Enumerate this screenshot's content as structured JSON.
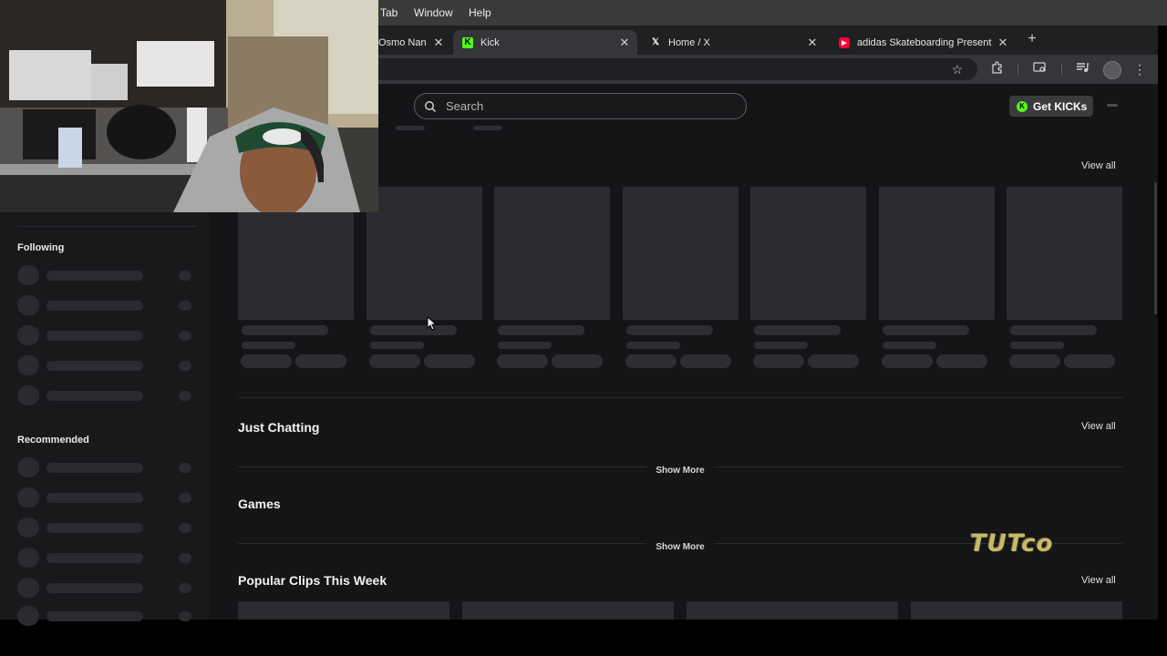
{
  "menubar": {
    "items": [
      "Tab",
      "Window",
      "Help"
    ]
  },
  "tabs": [
    {
      "title": "Osmo Nan",
      "active": false
    },
    {
      "title": "Kick",
      "active": true
    },
    {
      "title": "Home / X",
      "active": false
    },
    {
      "title": "adidas Skateboarding Present",
      "active": false
    }
  ],
  "search": {
    "placeholder": "Search"
  },
  "header": {
    "get_kicks_label": "Get KICKs"
  },
  "sections": {
    "view_all": "View all",
    "just_chatting": "Just Chatting",
    "games": "Games",
    "show_more": "Show More",
    "popular_clips": "Popular Clips This Week"
  },
  "sidebar": {
    "following": "Following",
    "recommended": "Recommended"
  },
  "watermark": "TUTco",
  "colors": {
    "kick_green": "#53fc18",
    "background": "#141517"
  },
  "icons": [
    "search-icon",
    "star-icon",
    "extensions-icon",
    "cast-icon",
    "media-icon",
    "profile-icon",
    "menu-icon",
    "close-icon",
    "plus-icon"
  ]
}
